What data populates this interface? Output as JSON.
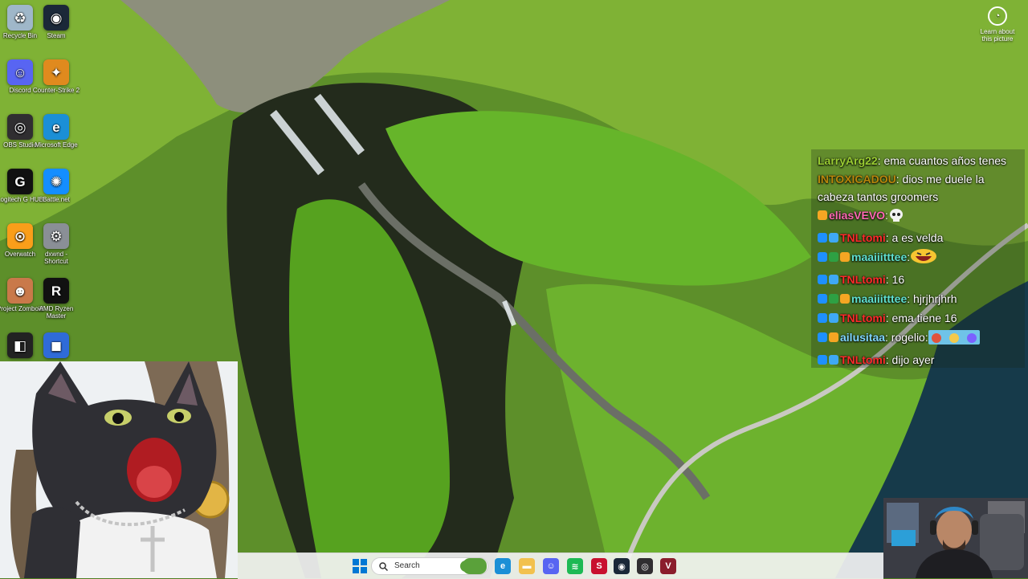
{
  "desktop": {
    "icons": [
      {
        "label": "Recycle Bin",
        "icon": "recycle-bin-icon",
        "color": "#9fb7c9",
        "glyph": "♻"
      },
      {
        "label": "Steam",
        "icon": "steam-icon",
        "color": "#1b2838",
        "glyph": "◉"
      },
      {
        "label": "Discord",
        "icon": "discord-icon",
        "color": "#5865f2",
        "glyph": "☺"
      },
      {
        "label": "Counter-Strike 2",
        "icon": "counter-strike-icon",
        "color": "#e08a1e",
        "glyph": "✦"
      },
      {
        "label": "OBS Studio",
        "icon": "obs-icon",
        "color": "#302e31",
        "glyph": "◎"
      },
      {
        "label": "Microsoft Edge",
        "icon": "edge-icon",
        "color": "#1b8fd6",
        "glyph": "e"
      },
      {
        "label": "Logitech G HUB",
        "icon": "logitech-icon",
        "color": "#111111",
        "glyph": "G"
      },
      {
        "label": "Battle.net",
        "icon": "battlenet-icon",
        "color": "#148eff",
        "glyph": "✺"
      },
      {
        "label": "Overwatch",
        "icon": "overwatch-icon",
        "color": "#f99e1a",
        "glyph": "⊙"
      },
      {
        "label": "dxwnd - Shortcut",
        "icon": "dxwnd-icon",
        "color": "#8a8f96",
        "glyph": "⚙"
      },
      {
        "label": "Project Zomboid",
        "icon": "zomboid-icon",
        "color": "#c9794a",
        "glyph": "☻"
      },
      {
        "label": "AMD Ryzen Master",
        "icon": "ryzen-icon",
        "color": "#111111",
        "glyph": "R"
      },
      {
        "label": "",
        "icon": "roblox-studio-icon",
        "color": "#222222",
        "glyph": "◧"
      },
      {
        "label": "",
        "icon": "roblox-icon",
        "color": "#2f6bd8",
        "glyph": "◼"
      }
    ],
    "learn_label": "Learn about this picture"
  },
  "chat": {
    "messages": [
      {
        "user": "LarryArg22",
        "user_color": "#9acd32",
        "text": ": ema cuantos años tenes",
        "badges": []
      },
      {
        "user": "INTOXICADOU",
        "user_color": "#b8860b",
        "text": ": dios me duele la cabeza tantos groomers",
        "badges": []
      },
      {
        "user": "eliasVEVO",
        "user_color": "#ff69b4",
        "text": ":",
        "badges": [
          "#f5a623"
        ],
        "emote": "skull-emote"
      },
      {
        "user": "TNLtomi",
        "user_color": "#ff2a2a",
        "text": ": a es velda",
        "badges": [
          "#1e90ff",
          "#3fa9f5"
        ]
      },
      {
        "user": "maaiiitttee",
        "user_color": "#5fe0d0",
        "text": ":",
        "badges": [
          "#1e90ff",
          "#2ea043",
          "#f5a623"
        ],
        "emote": "laugh-emote"
      },
      {
        "user": "TNLtomi",
        "user_color": "#ff2a2a",
        "text": ": 16",
        "badges": [
          "#1e90ff",
          "#3fa9f5"
        ]
      },
      {
        "user": "maaiiitttee",
        "user_color": "#5fe0d0",
        "text": ": hjrjhrjhrh",
        "badges": [
          "#1e90ff",
          "#2ea043",
          "#f5a623"
        ]
      },
      {
        "user": "TNLtomi",
        "user_color": "#ff2a2a",
        "text": ": ema tiene 16",
        "badges": [
          "#1e90ff",
          "#3fa9f5"
        ]
      },
      {
        "user": "ailusitaa",
        "user_color": "#7fd6ff",
        "text": ": rogelio:",
        "badges": [
          "#1e90ff",
          "#f5a623"
        ],
        "emote": "banner-emote"
      },
      {
        "user": "TNLtomi",
        "user_color": "#ff2a2a",
        "text": ": dijo ayer",
        "badges": [
          "#1e90ff",
          "#3fa9f5"
        ]
      }
    ]
  },
  "taskbar": {
    "search_placeholder": "Search",
    "apps": [
      {
        "icon": "start-icon",
        "color": "#0078d4"
      },
      {
        "icon": "widgets-icon",
        "color": "#5aa13a"
      },
      {
        "icon": "edge-taskbar-icon",
        "color": "#1b8fd6"
      },
      {
        "icon": "file-explorer-icon",
        "color": "#f2c14e"
      },
      {
        "icon": "discord-taskbar-icon",
        "color": "#5865f2"
      },
      {
        "icon": "spotify-icon",
        "color": "#1db954"
      },
      {
        "icon": "shadow-of-the-colossus-icon",
        "color": "#c8102e"
      },
      {
        "icon": "steam-taskbar-icon",
        "color": "#1b2838"
      },
      {
        "icon": "obs-taskbar-icon",
        "color": "#302e31"
      },
      {
        "icon": "valorant-icon",
        "color": "#8b1d2c"
      }
    ]
  }
}
